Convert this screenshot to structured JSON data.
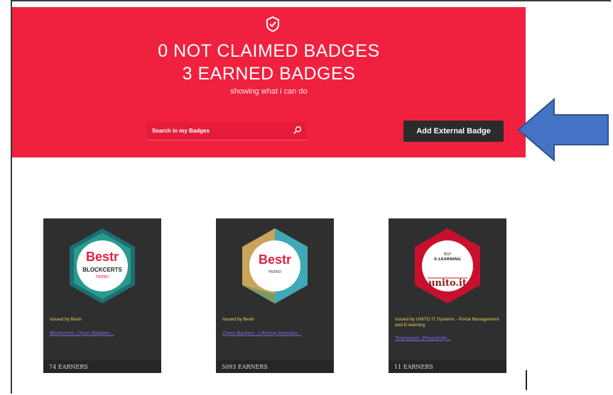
{
  "header": {
    "not_claimed": "0 NOT CLAIMED BADGES",
    "earned": "3 EARNED BADGES",
    "subtitle": "showing what i can do",
    "search_placeholder": "Search in my Badges",
    "add_button": "Add External Badge"
  },
  "badges": [
    {
      "issuer": "Issued by Bestr",
      "tags": "Blockcerts ,Open Badges...",
      "earners": "74 EARNERS",
      "logo": "Bestr",
      "subtitle": "BLOCKCERTS",
      "tag": "FRIEND"
    },
    {
      "issuer": "Issued by Bestr",
      "tags": "Open Badges ,Lifelong learning...",
      "earners": "5093 EARNERS",
      "logo": "Bestr",
      "tag": "FRIEND"
    },
    {
      "issuer": "Issued by UNITO IT Systems - Portal Management and E-learning",
      "tags": "Teamwork ,Proactivity...",
      "earners": "11 EARNERS",
      "logo": "unito.it",
      "line1": "BGF",
      "line2": "E-LEARNING"
    }
  ],
  "colors": {
    "banner": "#f0213f",
    "card": "#2f2f2f",
    "arrow": "#4472c4",
    "issuer_text": "#e8d25a",
    "tag_link": "#7b6ae0"
  }
}
